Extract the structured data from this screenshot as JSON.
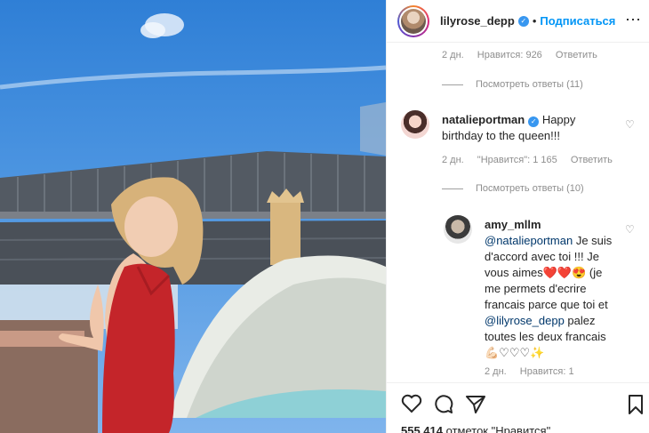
{
  "header": {
    "username": "lilyrose_depp",
    "dot": "•",
    "follow_label": "Подписаться",
    "more_icon": "more-horizontal-icon"
  },
  "first_comment": {
    "time": "2 дн.",
    "likes": "Нравится: 926",
    "reply": "Ответить",
    "view_replies": "Посмотреть ответы (11)"
  },
  "natalie": {
    "username": "natalieportman",
    "text": "Happy birthday to the queen!!!",
    "time": "2 дн.",
    "likes": "\"Нравится\": 1 165",
    "reply": "Ответить",
    "view_replies": "Посмотреть ответы (10)"
  },
  "amy": {
    "username": "amy_mllm",
    "mention1": "@natalieportman",
    "text1": " Je suis d'accord avec toi !!! Je vous aimes",
    "emoji1": "❤️❤️😍",
    "text2": " (je me permets d'ecrire francais parce que toi et ",
    "mention2": "@lilyrose_depp",
    "text3": " palez toutes les deux francais ",
    "emoji2": "💪🏻♡♡♡✨",
    "time": "2 дн.",
    "likes": "Нравится: 1"
  },
  "footer": {
    "likes_count": "555 414",
    "likes_label": "отметок \"Нравится\""
  },
  "colors": {
    "accent": "#0095f6",
    "verified": "#3897f0",
    "muted": "#8e8e8e"
  }
}
